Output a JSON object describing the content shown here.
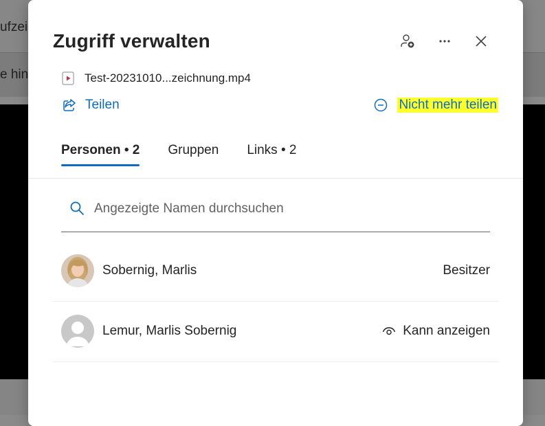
{
  "background": {
    "text_top": "ufzei",
    "text_mid": "e hin"
  },
  "dialog": {
    "title": "Zugriff verwalten",
    "file_name": "Test-20231010...zeichnung.mp4",
    "share_label": "Teilen",
    "stop_sharing_label": "Nicht mehr teilen",
    "header_icons": [
      "add-person-icon",
      "more-options-icon",
      "close-icon"
    ]
  },
  "tabs": [
    {
      "label": "Personen • 2",
      "active": true
    },
    {
      "label": "Gruppen",
      "active": false
    },
    {
      "label": "Links • 2",
      "active": false
    }
  ],
  "search": {
    "placeholder": "Angezeigte Namen durchsuchen"
  },
  "people": [
    {
      "name": "Sobernig, Marlis",
      "role": "Besitzer",
      "role_icon": null,
      "avatar": "photo"
    },
    {
      "name": "Lemur, Marlis Sobernig",
      "role": "Kann anzeigen",
      "role_icon": "eye-icon",
      "avatar": "placeholder"
    }
  ],
  "colors": {
    "accent": "#0f6cbd",
    "highlight": "#ffff2e",
    "text": "#242424"
  }
}
